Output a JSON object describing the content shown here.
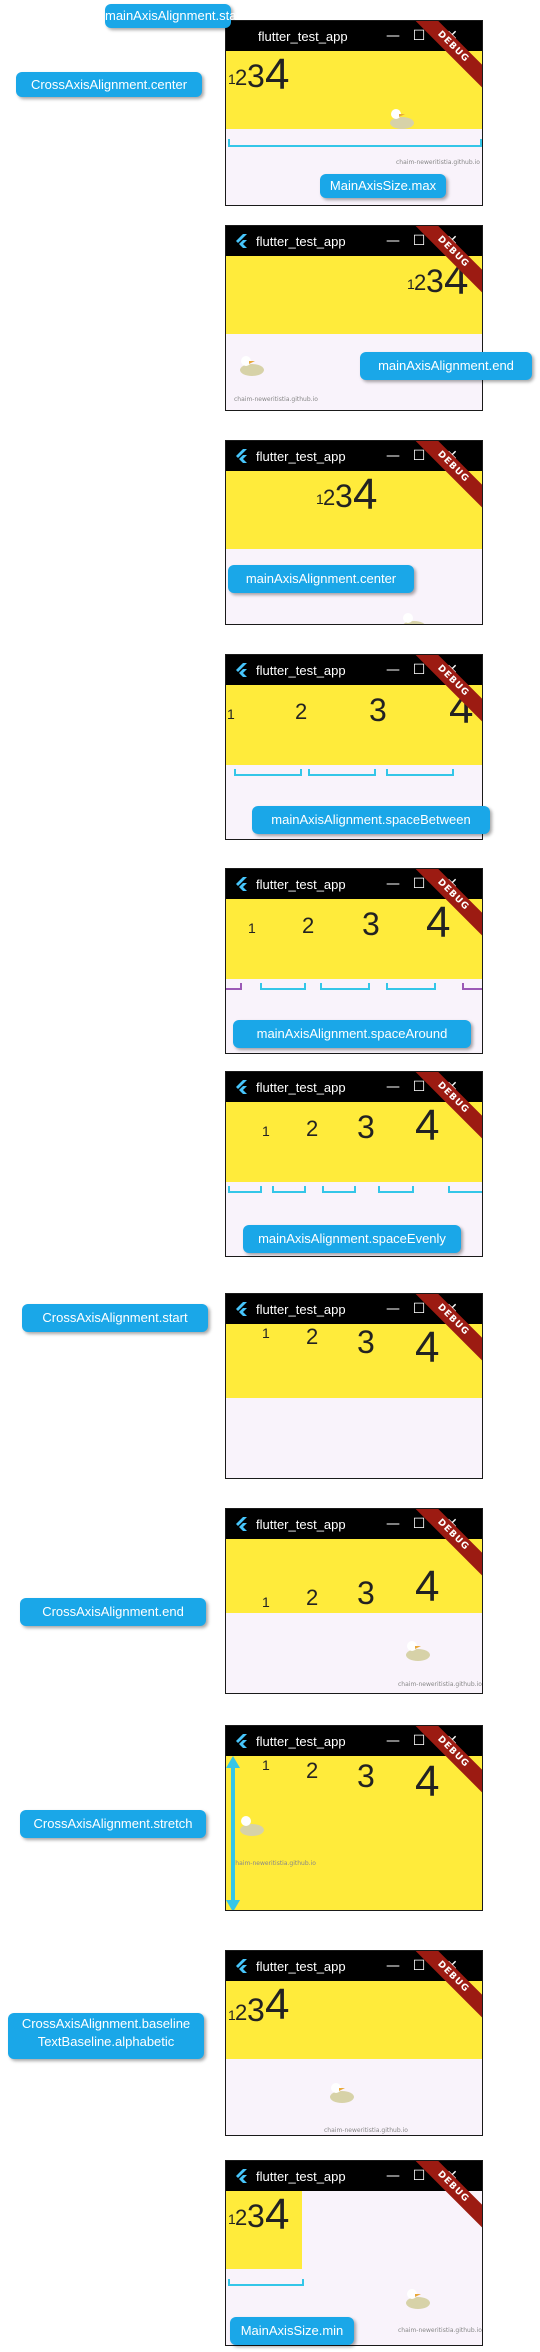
{
  "window": {
    "title": "flutter_test_app",
    "icons": [
      "flutter-icon",
      "minimize-icon",
      "maximize-icon",
      "close-icon"
    ],
    "debug_banner": "DEBUG",
    "watermark": "chaim-neweritistia.github.io"
  },
  "digits": [
    "1",
    "2",
    "3",
    "4"
  ],
  "labels": {
    "main_start": "mainAxisAlignment.start",
    "cross_center": "CrossAxisAlignment.center",
    "size_max": "MainAxisSize.max",
    "main_end": "mainAxisAlignment.end",
    "main_center": "mainAxisAlignment.center",
    "space_between": "mainAxisAlignment.spaceBetween",
    "space_around": "mainAxisAlignment.spaceAround",
    "space_evenly": "mainAxisAlignment.spaceEvenly",
    "cross_start": "CrossAxisAlignment.start",
    "cross_end": "CrossAxisAlignment.end",
    "cross_stretch": "CrossAxisAlignment.stretch",
    "cross_baseline_1": "CrossAxisAlignment.baseline",
    "cross_baseline_2": "TextBaseline.alphabetic",
    "size_min": "MainAxisSize.min"
  },
  "colors": {
    "accent": "#1aa7e8",
    "yellow": "#ffeb3b",
    "window_bg": "#f9f3fb",
    "titlebar": "#000000",
    "ribbon": "#9c1b12",
    "brace": "#34c6e8"
  }
}
